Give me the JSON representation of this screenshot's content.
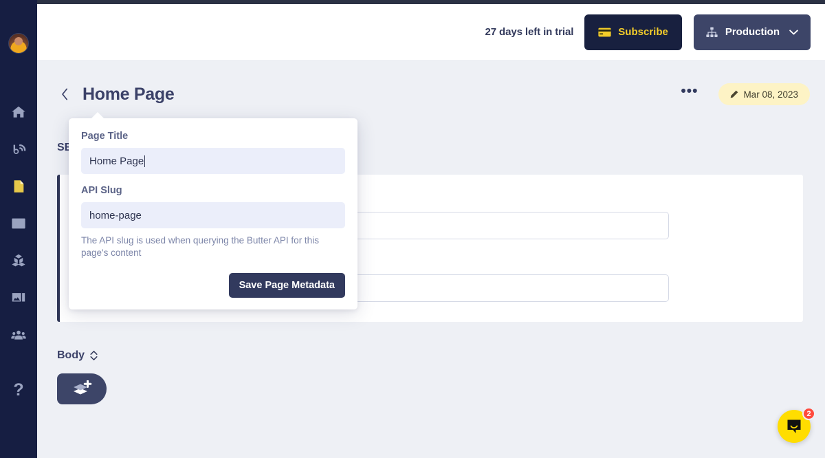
{
  "header": {
    "trial_text": "27 days left in trial",
    "subscribe_label": "Subscribe",
    "environment_label": "Production"
  },
  "page": {
    "title": "Home Page",
    "back_label": "‹",
    "overflow_label": "•••",
    "date_badge": "Mar 08, 2023",
    "seo_section_label": "SEO"
  },
  "popover": {
    "page_title_label": "Page Title",
    "page_title_value": "Home Page",
    "api_slug_label": "API Slug",
    "api_slug_value": "home-page",
    "help_text": "The API slug is used when querying the Butter API for this page's content",
    "save_label": "Save Page Metadata"
  },
  "body_section": {
    "label": "Body"
  },
  "chat": {
    "unread_count": "2"
  },
  "sidebar": {
    "items": [
      {
        "name": "home",
        "label": "Home"
      },
      {
        "name": "blog",
        "label": "Blog"
      },
      {
        "name": "pages",
        "label": "Pages",
        "active": true
      },
      {
        "name": "collections",
        "label": "Collections"
      },
      {
        "name": "components",
        "label": "Components"
      },
      {
        "name": "media",
        "label": "Media"
      },
      {
        "name": "team",
        "label": "Team"
      }
    ],
    "help_label": "?"
  },
  "colors": {
    "sidebar_bg": "#161e42",
    "page_bg": "#eef0f5",
    "accent_yellow": "#f4cd2a",
    "subscribe_bg": "#18203f",
    "production_bg": "#3d4568",
    "primary_text": "#3b4168",
    "date_badge_bg": "#fdf3c5",
    "chat_bg": "#ffdd00",
    "badge_red": "#ff4a3d",
    "input_bg": "#ebeefa"
  }
}
